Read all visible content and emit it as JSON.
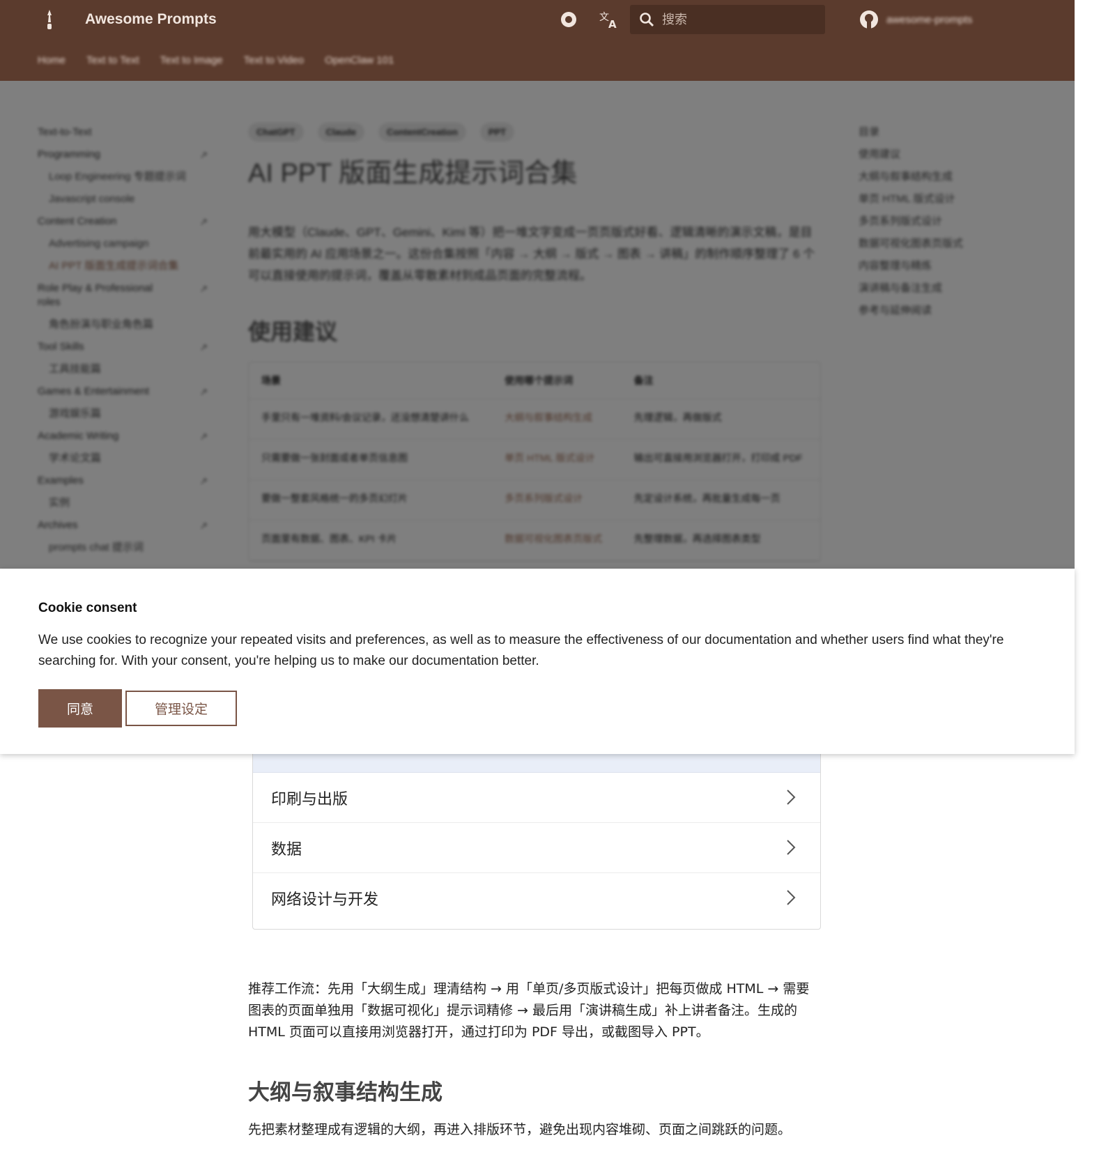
{
  "header": {
    "site_title": "Awesome Prompts",
    "search_placeholder": "搜索",
    "repo_label": "awesome-prompts",
    "tabs": [
      "Home",
      "Text to Text",
      "Text to Image",
      "Text to Video",
      "OpenClaw 101"
    ],
    "colors": {
      "header_bg": "#5b3b2d",
      "accent": "#7a5546"
    },
    "icons": [
      "logo-icon",
      "palette-icon",
      "translate-icon",
      "search-icon",
      "github-icon"
    ]
  },
  "sidebar": {
    "items": [
      {
        "label": "Text-to-Text",
        "level": 0,
        "expandable": false
      },
      {
        "label": "Programming",
        "level": 0,
        "expandable": true
      },
      {
        "label": "Loop Engineering 专题提示词",
        "level": 1
      },
      {
        "label": "Javascript console",
        "level": 1
      },
      {
        "label": "Content Creation",
        "level": 0,
        "expandable": true
      },
      {
        "label": "Advertising campaign",
        "level": 1
      },
      {
        "label": "AI PPT 版面生成提示词合集",
        "level": 1,
        "active": true
      },
      {
        "label": "Role Play & Professional roles",
        "level": 0,
        "expandable": true
      },
      {
        "label": "角色扮演与职业角色篇",
        "level": 1
      },
      {
        "label": "Tool Skills",
        "level": 0,
        "expandable": true
      },
      {
        "label": "工具技能篇",
        "level": 1
      },
      {
        "label": "Games & Entertainment",
        "level": 0,
        "expandable": true
      },
      {
        "label": "游戏娱乐篇",
        "level": 1
      },
      {
        "label": "Academic Writing",
        "level": 0,
        "expandable": true
      },
      {
        "label": "学术论文篇",
        "level": 1
      },
      {
        "label": "Examples",
        "level": 0,
        "expandable": true
      },
      {
        "label": "实例",
        "level": 1
      },
      {
        "label": "Archives",
        "level": 0,
        "expandable": true
      },
      {
        "label": "prompts chat 提示词",
        "level": 1
      }
    ]
  },
  "article": {
    "tags": [
      "ChatGPT",
      "Claude",
      "ContentCreation",
      "PPT"
    ],
    "title": "AI PPT 版面生成提示词合集",
    "lead": "用大模型（Claude、GPT、Gemini、Kimi 等）把一堆文字变成一页页版式好看、逻辑清晰的演示文稿，是目前最实用的 AI 应用场景之一。这份合集按照「内容 → 大纲 → 版式 → 图表 → 讲稿」的制作顺序整理了 6 个可以直接使用的提示词，覆盖从零散素材到成品页面的完整流程。",
    "section_usage": "使用建议",
    "table": {
      "headers": [
        "场景",
        "使用哪个提示词",
        "备注"
      ],
      "rows": [
        [
          "手里只有一堆资料/会议记录，还没想清楚讲什么",
          "大纲与叙事结构生成",
          "先理逻辑，再做版式"
        ],
        [
          "只需要做一张封面或者单页信息图",
          "单页 HTML 版式设计",
          "输出可直接用浏览器打开，打印成 PDF"
        ],
        [
          "要做一整套风格统一的多页幻灯片",
          "多页系列版式设计",
          "先定设计系统，再批量生成每一页"
        ],
        [
          "页面里有数据、图表、KPI 卡片",
          "数据可视化图表页版式",
          "先整理数据，再选择图表类型"
        ]
      ]
    },
    "categories": [
      "印刷与出版",
      "数据",
      "网络设计与开发"
    ],
    "workflow": "推荐工作流：先用「大纲生成」理清结构 → 用「单页/多页版式设计」把每页做成 HTML → 需要图表的页面单独用「数据可视化」提示词精修 → 最后用「演讲稿生成」补上讲者备注。生成的 HTML 页面可以直接用浏览器打开，通过打印为 PDF 导出，或截图导入 PPT。",
    "section_outline": "大纲与叙事结构生成",
    "outline_intro": "先把素材整理成有逻辑的大纲，再进入排版环节，避免出现内容堆砌、页面之间跳跃的问题。"
  },
  "toc": {
    "title": "目录",
    "items": [
      "使用建议",
      "大纲与叙事结构生成",
      "单页 HTML 版式设计",
      "多页系列版式设计",
      "数据可视化图表页版式",
      "内容整理与精炼",
      "演讲稿与备注生成",
      "参考与延伸阅读"
    ]
  },
  "consent": {
    "title": "Cookie consent",
    "text": "We use cookies to recognize your repeated visits and preferences, as well as to measure the effectiveness of our documentation and whether users find what they're searching for. With your consent, you're helping us to make our documentation better.",
    "accept_label": "同意",
    "manage_label": "管理设定"
  }
}
